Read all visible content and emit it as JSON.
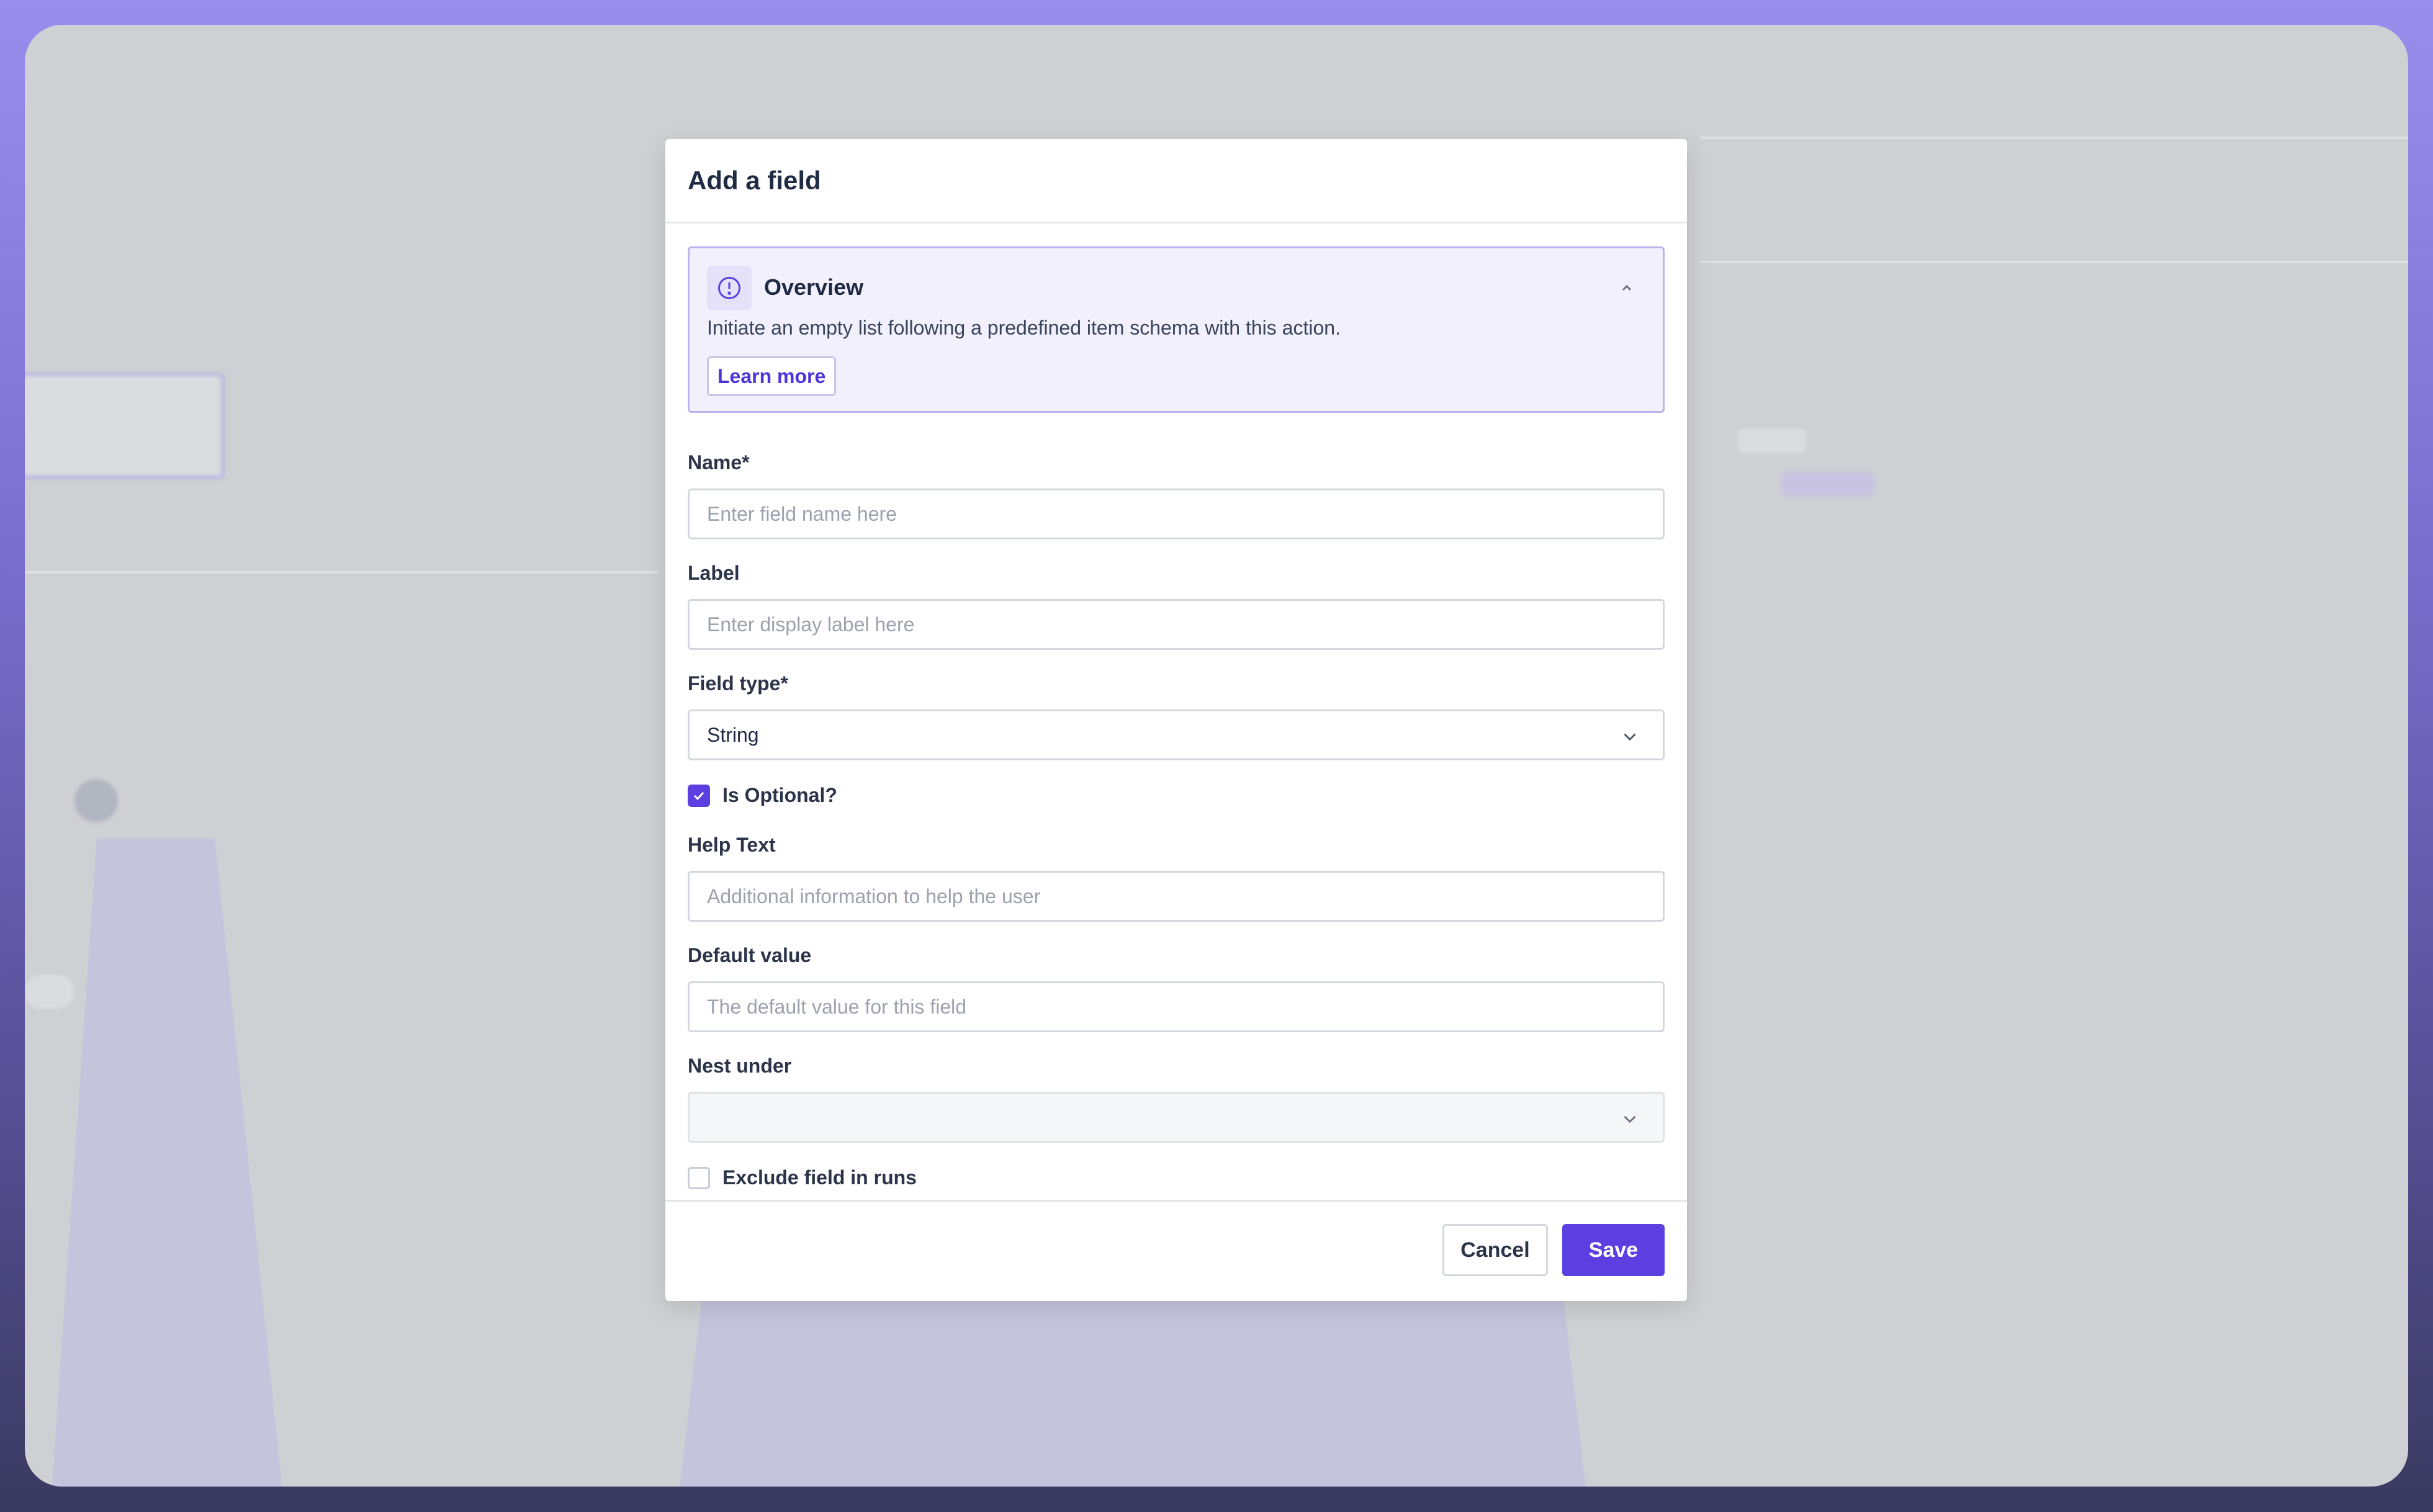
{
  "dialog": {
    "title": "Add a field",
    "overview": {
      "title": "Overview",
      "description": "Initiate an empty list following a predefined item schema with this action.",
      "learn_more": "Learn more",
      "icon": "info-circle-icon",
      "collapse_icon": "chevron-up-icon"
    },
    "fields": {
      "name": {
        "label": "Name*",
        "placeholder": "Enter field name here",
        "value": ""
      },
      "label": {
        "label": "Label",
        "placeholder": "Enter display label here",
        "value": ""
      },
      "field_type": {
        "label": "Field type*",
        "value": "String",
        "icon": "chevron-down-icon"
      },
      "is_optional": {
        "label": "Is Optional?",
        "checked": true
      },
      "help_text": {
        "label": "Help Text",
        "placeholder": "Additional information to help the user",
        "value": ""
      },
      "default_value": {
        "label": "Default value",
        "placeholder": "The default value for this field",
        "value": ""
      },
      "nest_under": {
        "label": "Nest under",
        "value": "",
        "icon": "chevron-down-icon"
      },
      "exclude_in_runs": {
        "label": "Exclude field in runs",
        "checked": false
      }
    },
    "footer": {
      "cancel": "Cancel",
      "save": "Save"
    }
  },
  "colors": {
    "accent": "#5b3fe0",
    "overview_bg": "#f1f0fc",
    "overview_border": "#b9b3ee"
  }
}
